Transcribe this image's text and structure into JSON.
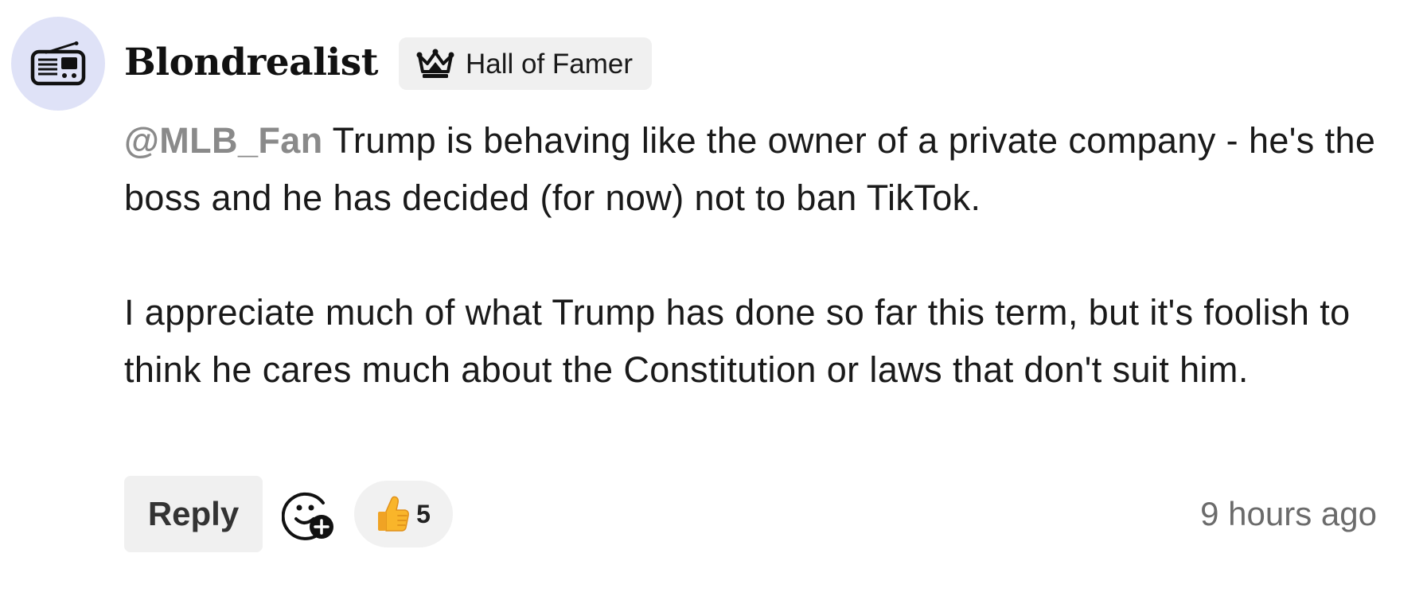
{
  "comment": {
    "author": {
      "username": "Blondrealist",
      "avatar_icon": "radio-icon",
      "avatar_bg": "#dfe2f7",
      "badge": {
        "icon": "crown-icon",
        "label": "Hall of Famer"
      }
    },
    "body": {
      "mention": "@MLB_Fan",
      "paragraph_1": " Trump is behaving like the owner of a private company - he's the boss and he has decided (for now) not to ban TikTok.",
      "paragraph_2": "I appreciate much of what Trump has done so far this term, but it's foolish to think he cares much about the Constitution or laws that don't suit him."
    },
    "actions": {
      "reply_label": "Reply",
      "add_reaction_icon": "add-emoji-icon",
      "reactions": [
        {
          "emoji": "thumbs-up-icon",
          "count": "5"
        }
      ]
    },
    "timestamp": "9 hours ago"
  }
}
